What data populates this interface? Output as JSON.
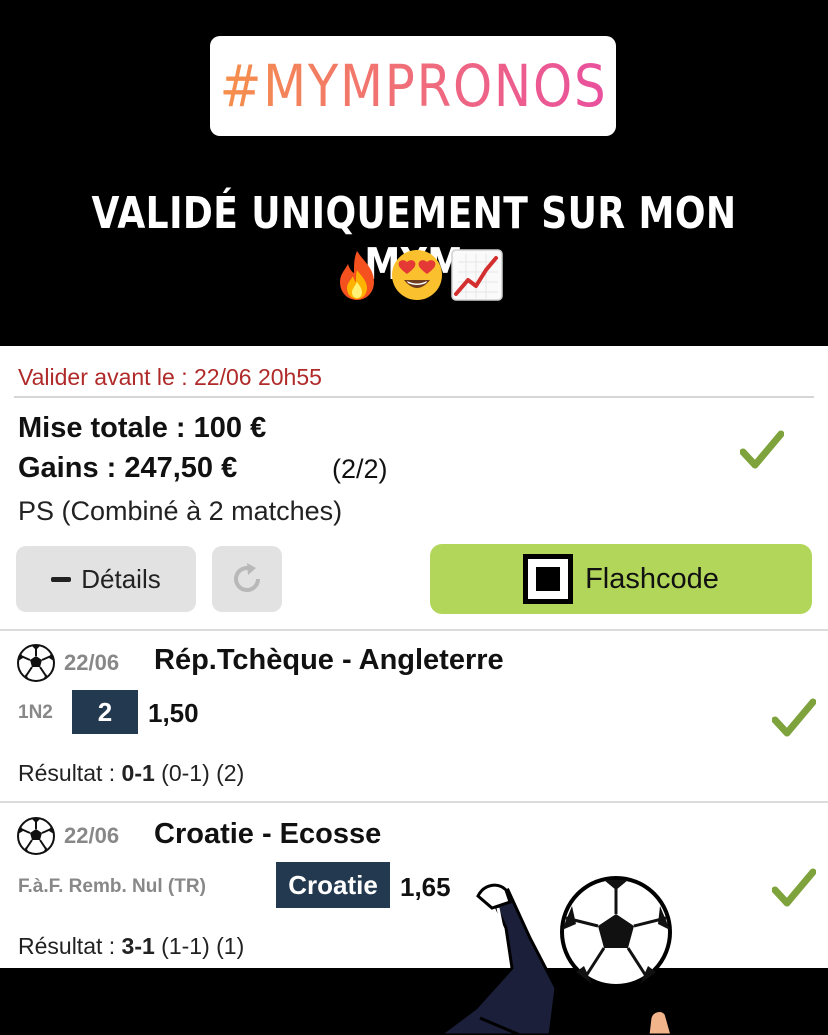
{
  "story": {
    "hashtag": "#MYMPRONOS",
    "headline": "VALIDÉ UNIQUEMENT SUR MON MYM",
    "emojis": [
      "fire-emoji",
      "heart-eyes-emoji",
      "chart-increasing-emoji"
    ]
  },
  "ticket": {
    "deadline_label": "Valider avant le : 22/06 20h55",
    "stake_label": "Mise totale : 100 €",
    "gains_label": "Gains : 247,50 €",
    "gains_count": "(2/2)",
    "bet_type": "PS (Combiné à 2 matches)",
    "status_icon": "check-icon",
    "buttons": {
      "details_label": "Détails",
      "flashcode_label": "Flashcode"
    },
    "colors": {
      "deadline": "#b02a2a",
      "check": "#7ea33c",
      "flashcode_bg": "#b2d65a",
      "pick_bg": "#23394f"
    }
  },
  "matches": [
    {
      "date": "22/06",
      "teams": "Rép.Tchèque - Angleterre",
      "market": "1N2",
      "pick": "2",
      "odds": "1,50",
      "result_prefix": "Résultat : ",
      "result_score": "0-1",
      "result_detail": " (0-1) (2)"
    },
    {
      "date": "22/06",
      "teams": "Croatie - Ecosse",
      "market": "F.à.F. Remb. Nul (TR)",
      "pick": "Croatie",
      "odds": "1,65",
      "result_prefix": "Résultat : ",
      "result_score": "3-1",
      "result_detail": " (1-1) (1)"
    }
  ]
}
